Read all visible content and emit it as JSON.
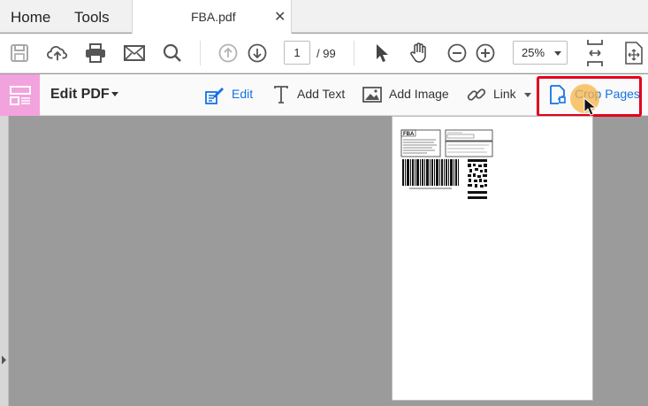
{
  "tabs": {
    "home": "Home",
    "tools": "Tools",
    "document": "FBA.pdf",
    "close": "✕"
  },
  "toolbar": {
    "page_current": "1",
    "page_total": "/ 99",
    "zoom": "25%",
    "icons": [
      "save-icon",
      "cloud-upload-icon",
      "print-icon",
      "email-icon",
      "search-icon",
      "prev-page-icon",
      "next-page-icon",
      "select-cursor-icon",
      "hand-tool-icon",
      "zoom-out-icon",
      "zoom-in-icon",
      "fit-page-icon",
      "full-screen-icon"
    ]
  },
  "edit_toolbar": {
    "title": "Edit PDF",
    "edit": "Edit",
    "add_text": "Add Text",
    "add_image": "Add Image",
    "link": "Link",
    "crop_pages": "Crop Pages"
  },
  "document": {
    "label_header": "FBA"
  },
  "colors": {
    "accent": "#1473e6",
    "edit_badge": "#f2a3de",
    "highlight": "#e3001b",
    "cursor_halo": "#f7b446"
  }
}
